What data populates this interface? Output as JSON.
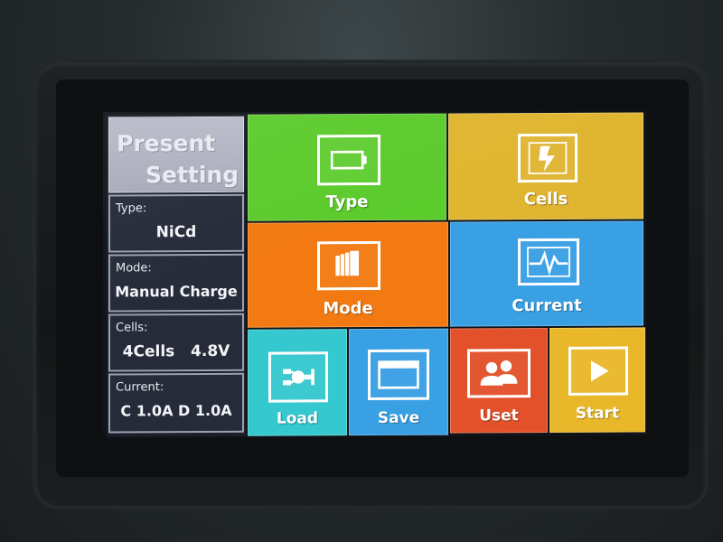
{
  "sidebar": {
    "title_line1": "Present",
    "title_line2": "Setting",
    "type": {
      "label": "Type:",
      "value": "NiCd"
    },
    "mode": {
      "label": "Mode:",
      "value": "Manual Charge"
    },
    "cells": {
      "label": "Cells:",
      "value": "4Cells   4.8V"
    },
    "current": {
      "label": "Current:",
      "value": "C 1.0A D 1.0A"
    }
  },
  "tiles": {
    "type": {
      "label": "Type",
      "icon": "battery-icon",
      "color": "#5ccb2c"
    },
    "cells": {
      "label": "Cells",
      "icon": "lightning-icon",
      "color": "#e0b531"
    },
    "mode": {
      "label": "Mode",
      "icon": "stack-icon",
      "color": "#f37a12"
    },
    "current": {
      "label": "Current",
      "icon": "waveform-icon",
      "color": "#3aa0e4"
    },
    "load": {
      "label": "Load",
      "icon": "plug-icon",
      "color": "#35c8cf"
    },
    "save": {
      "label": "Save",
      "icon": "window-icon",
      "color": "#3aa0e4"
    },
    "uset": {
      "label": "Uset",
      "icon": "users-icon",
      "color": "#e2512a"
    },
    "start": {
      "label": "Start",
      "icon": "play-icon",
      "color": "#e9b82a"
    }
  }
}
